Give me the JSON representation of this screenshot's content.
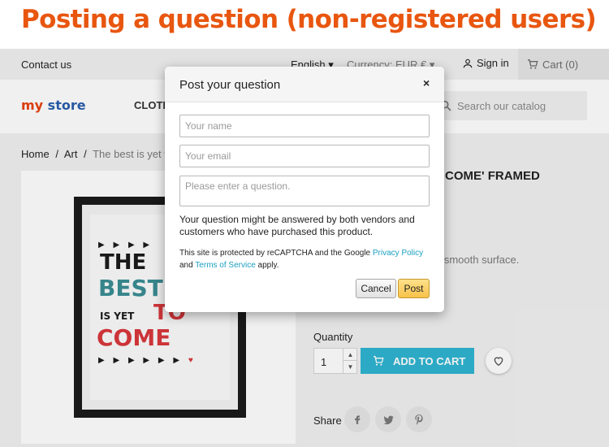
{
  "banner": {
    "title": "Posting a question (non-registered users)"
  },
  "topbar": {
    "contact": "Contact us",
    "language": "English ▾",
    "currency": "Currency: EUR € ▾",
    "signin": "Sign in",
    "cart": "Cart (0)"
  },
  "header": {
    "logo_a": "my ",
    "logo_b": "store",
    "menu_item": "CLOTH",
    "search_placeholder": "Search our catalog"
  },
  "breadcrumb": {
    "home": "Home",
    "sep": "/",
    "art": "Art",
    "current": "The best is yet t"
  },
  "poster": {
    "arrows_top": "▶ ▶ ▶ ▶",
    "the": "THE",
    "best": "BEST",
    "is_yet": "IS YET",
    "to": "TO",
    "come": "COME",
    "arrows_bottom": "▶ ▶ ▶ ▶ ▶ ▶",
    "heart": "♥"
  },
  "product": {
    "title_fragment": "COME' FRAMED",
    "desc_fragment": "d smooth surface.",
    "quantity_label": "Quantity",
    "quantity_value": "1",
    "add_to_cart": "ADD TO CART",
    "share_label": "Share"
  },
  "modal": {
    "title": "Post your question",
    "close": "×",
    "name_placeholder": "Your name",
    "email_placeholder": "Your email",
    "question_placeholder": "Please enter a question.",
    "note": "Your question might be answered by both vendors and customers who have purchased this product.",
    "recaptcha_pre": "This site is protected by reCAPTCHA and the Google ",
    "privacy_link": "Privacy Policy",
    "recaptcha_and": " and ",
    "terms_link": "Terms of Service",
    "recaptcha_post": " apply.",
    "cancel": "Cancel",
    "post": "Post"
  },
  "colors": {
    "banner_text": "#e8560f",
    "accent": "#2fb5d2",
    "post_button": "#f7c24a",
    "link": "#1a9fc2"
  },
  "icons": [
    "user-icon",
    "cart-icon",
    "search-icon",
    "heart-icon",
    "facebook-icon",
    "twitter-icon",
    "pinterest-icon",
    "close-icon"
  ]
}
